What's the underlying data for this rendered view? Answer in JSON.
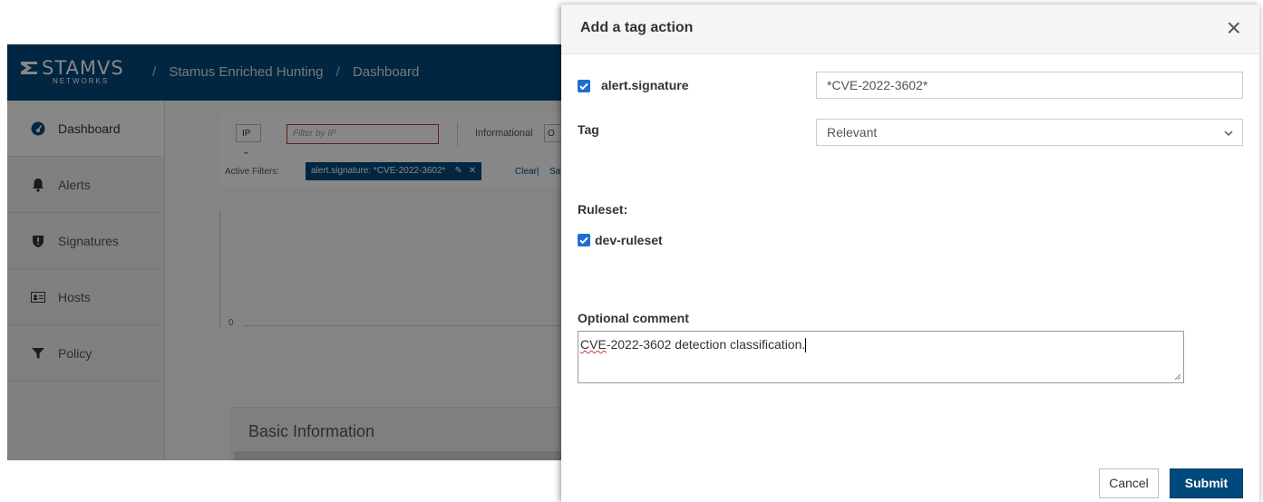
{
  "app": {
    "logo": {
      "main": "STAMVS",
      "sub": "NETWORKS"
    },
    "breadcrumb": [
      "Stamus Enriched Hunting",
      "Dashboard"
    ],
    "breadcrumb_separator": "/",
    "sidebar": [
      {
        "label": "Dashboard",
        "icon": "dashboard-icon",
        "active": true
      },
      {
        "label": "Alerts",
        "icon": "bell-icon",
        "active": false
      },
      {
        "label": "Signatures",
        "icon": "shield-icon",
        "active": false
      },
      {
        "label": "Hosts",
        "icon": "id-card-icon",
        "active": false
      },
      {
        "label": "Policy",
        "icon": "filter-icon",
        "active": false
      }
    ],
    "toolbar": {
      "ip_dropdown": "IP",
      "filter_placeholder": "Filter by IP",
      "informational_label": "Informational",
      "informational_value": "O"
    },
    "active_filters": {
      "label": "Active Filters:",
      "tag": "alert.signature: *CVE-2022-3602*",
      "clear": "Clear|",
      "save_partial": "Sa"
    },
    "chart_zero": "0",
    "basic_info_title": "Basic Information"
  },
  "modal": {
    "title": "Add a tag action",
    "close": "×",
    "signature_label": "alert.signature",
    "signature_checked": true,
    "signature_value": "*CVE-2022-3602*",
    "tag_label": "Tag",
    "tag_value": "Relevant",
    "ruleset_label": "Ruleset:",
    "ruleset_item": "dev-ruleset",
    "ruleset_checked": true,
    "comment_label": "Optional comment",
    "comment_spell": "CVE",
    "comment_rest": "-2022-3602 detection classification.",
    "cancel": "Cancel",
    "submit": "Submit"
  },
  "colors": {
    "brand": "#00497b",
    "checkbox": "#1e6fd0",
    "filter_border": "#c9302c"
  }
}
